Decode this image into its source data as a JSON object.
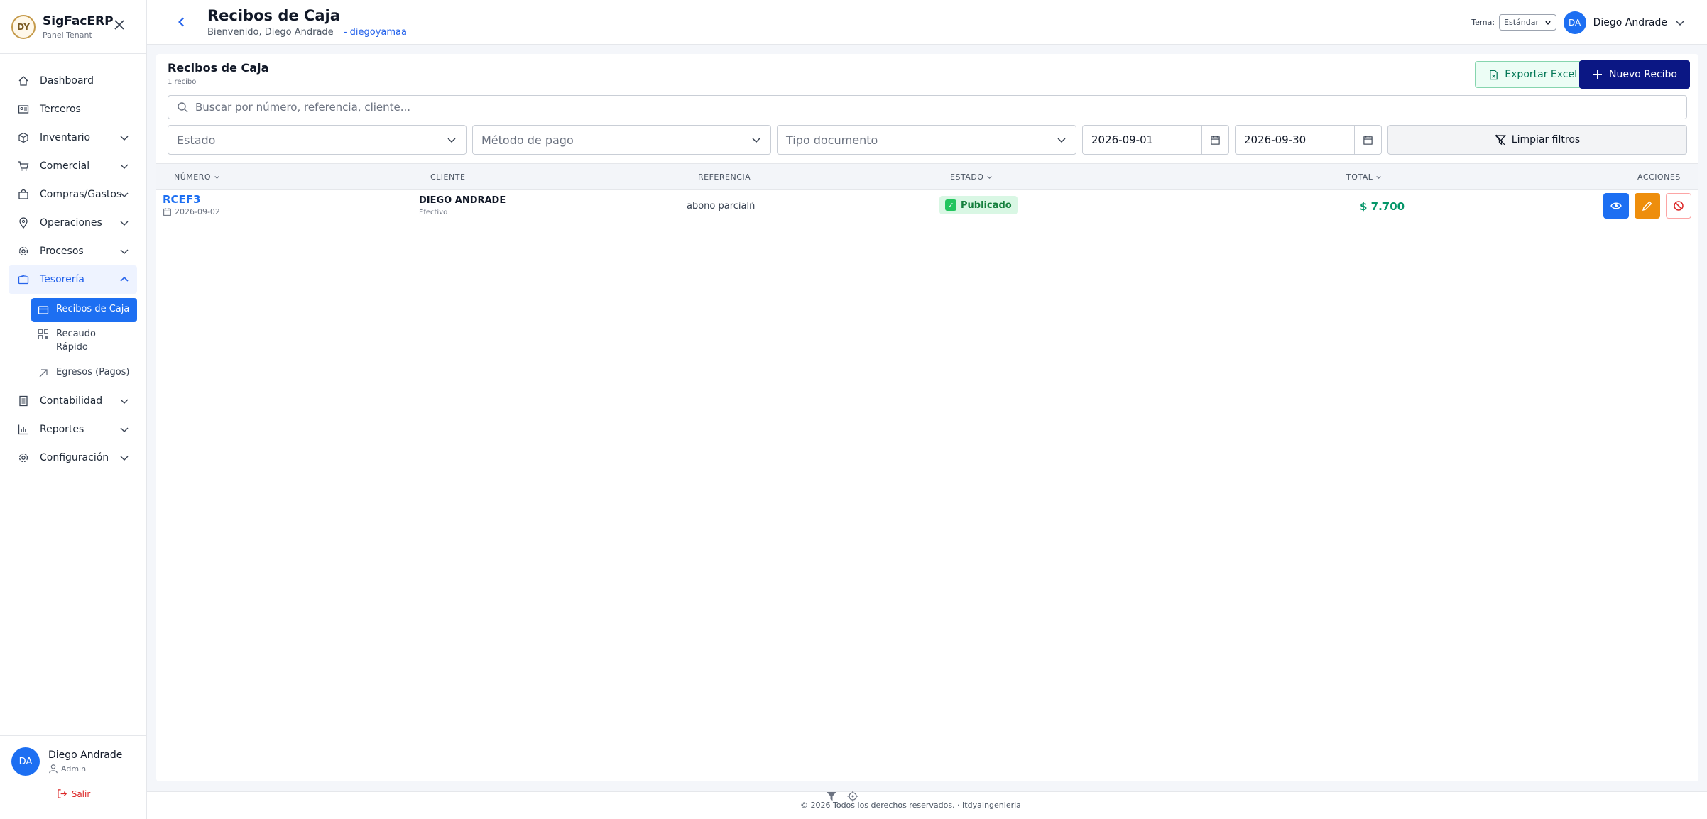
{
  "sidebar": {
    "brand_name": "SigFacERP",
    "brand_sub": "Panel Tenant",
    "logo_text": "DY",
    "items": [
      {
        "label": "Dashboard",
        "icon": "home-icon"
      },
      {
        "label": "Terceros",
        "icon": "id-card-icon"
      },
      {
        "label": "Inventario",
        "icon": "box-icon"
      },
      {
        "label": "Comercial",
        "icon": "cart-icon"
      },
      {
        "label": "Compras/Gastos",
        "icon": "bag-icon"
      },
      {
        "label": "Operaciones",
        "icon": "location-icon"
      },
      {
        "label": "Procesos",
        "icon": "gear-icon"
      },
      {
        "label": "Tesorería",
        "icon": "wallet-icon"
      },
      {
        "label": "Contabilidad",
        "icon": "ledger-icon"
      },
      {
        "label": "Reportes",
        "icon": "bar-chart-icon"
      },
      {
        "label": "Configuración",
        "icon": "gear-icon"
      }
    ],
    "sub_items": [
      {
        "label": "Recibos de Caja",
        "icon": "receipt-icon"
      },
      {
        "label": "Recaudo Rápido",
        "icon": "qr-icon"
      },
      {
        "label": "Egresos (Pagos)",
        "icon": "arrow-up-right-icon"
      }
    ],
    "user": {
      "initials": "DA",
      "name": "Diego Andrade",
      "role": "Admin",
      "logout": "Salir"
    }
  },
  "header": {
    "title": "Recibos de Caja",
    "welcome": "Bienvenido, Diego Andrade",
    "tenant": "- diegoyamaa",
    "theme_label": "Tema:",
    "theme_value": "Estándar",
    "user_initials": "DA",
    "user_name": "Diego Andrade"
  },
  "main": {
    "title": "Recibos de Caja",
    "count": "1 recibo",
    "export_label": "Exportar Excel",
    "new_label": "Nuevo Recibo",
    "search_placeholder": "Buscar por número, referencia, cliente...",
    "filters": {
      "estado": "Estado",
      "metodo": "Método de pago",
      "tipo": "Tipo documento",
      "date_from": "2026-09-01",
      "date_to": "2026-09-30",
      "clear_label": "Limpiar filtros"
    },
    "columns": [
      "NÚMERO",
      "CLIENTE",
      "REFERENCIA",
      "ESTADO",
      "TOTAL",
      "ACCIONES"
    ],
    "rows": [
      {
        "numero": "RCEF3",
        "fecha": "2026-09-02",
        "cliente": "DIEGO ANDRADE",
        "metodo": "Efectivo",
        "referencia": "abono parcialñ",
        "estado": "Publicado",
        "total": "$ 7.700"
      }
    ]
  },
  "footer": {
    "text": "© 2026  Todos los derechos reservados. · ItdyaIngenieria"
  },
  "colors": {
    "primary": "#1d6ff2",
    "navy": "#0b1784",
    "success": "#059669",
    "warning": "#ee8e0c"
  }
}
